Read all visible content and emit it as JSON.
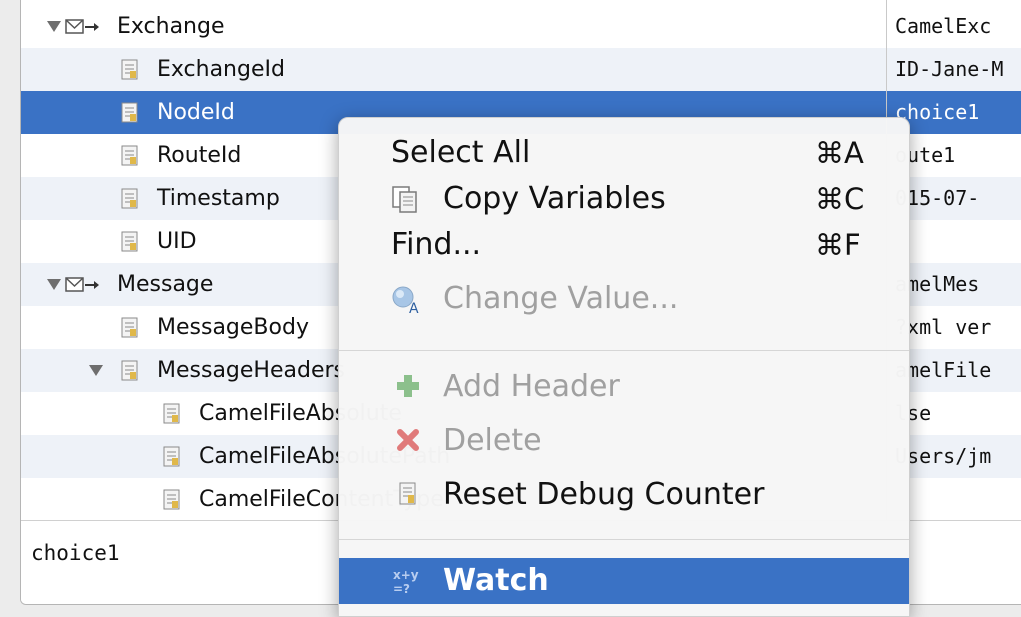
{
  "tree": {
    "rows": [
      {
        "label": "Exchange",
        "value": "CamelExc"
      },
      {
        "label": "ExchangeId",
        "value": "ID-Jane-M"
      },
      {
        "label": "NodeId",
        "value": "choice1"
      },
      {
        "label": "RouteId",
        "value": "oute1"
      },
      {
        "label": "Timestamp",
        "value": "015-07-"
      },
      {
        "label": "UID",
        "value": ""
      },
      {
        "label": "Message",
        "value": "amelMes"
      },
      {
        "label": "MessageBody",
        "value": "?xml ver"
      },
      {
        "label": "MessageHeaders",
        "value": "amelFile"
      },
      {
        "label": "CamelFileAbsolute",
        "value": "lse"
      },
      {
        "label": "CamelFileAbsolutePath",
        "value": "Users/jm"
      },
      {
        "label": "CamelFileContentType",
        "value": ""
      }
    ]
  },
  "detail": {
    "text": "choice1"
  },
  "menu": {
    "items": [
      {
        "label": "Select All",
        "shortcut": "⌘A"
      },
      {
        "label": "Copy Variables",
        "shortcut": "⌘C"
      },
      {
        "label": "Find...",
        "shortcut": "⌘F"
      },
      {
        "label": "Change Value...",
        "shortcut": ""
      },
      {
        "label": "Add Header",
        "shortcut": ""
      },
      {
        "label": "Delete",
        "shortcut": ""
      },
      {
        "label": "Reset Debug Counter",
        "shortcut": ""
      },
      {
        "label": "Watch",
        "shortcut": ""
      }
    ]
  },
  "colors": {
    "selection": "#3a72c5",
    "alt_row": "#eef2f8"
  }
}
